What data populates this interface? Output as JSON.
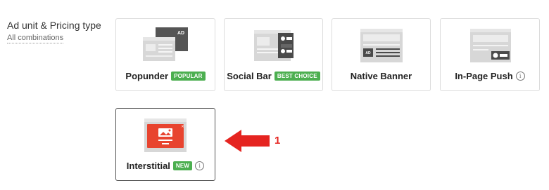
{
  "section": {
    "title": "Ad unit & Pricing type",
    "link": "All combinations"
  },
  "cards": [
    {
      "label": "Popunder",
      "badge": "POPULAR",
      "icon": "popunder-icon"
    },
    {
      "label": "Social Bar",
      "badge": "BEST CHOICE",
      "icon": "social-bar-icon"
    },
    {
      "label": "Native Banner",
      "icon": "native-banner-icon"
    },
    {
      "label": "In-Page Push",
      "info": "i",
      "icon": "in-page-push-icon"
    },
    {
      "label": "Interstitial",
      "badge": "NEW",
      "info": "i",
      "icon": "interstitial-icon"
    }
  ],
  "thumb_texts": {
    "ad": "AD"
  },
  "annotation": {
    "number": "1"
  },
  "colors": {
    "badge": "#4caf50",
    "arrow": "#e52420",
    "interstitial_card": "#e8442f"
  }
}
